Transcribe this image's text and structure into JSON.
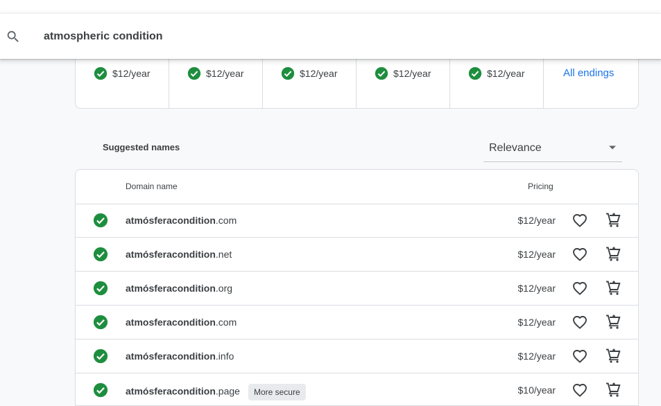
{
  "search": {
    "value": "atmospheric condition",
    "icon": "search-icon"
  },
  "endings": {
    "items": [
      {
        "price": "$12/year"
      },
      {
        "price": "$12/year"
      },
      {
        "price": "$12/year"
      },
      {
        "price": "$12/year"
      },
      {
        "price": "$12/year"
      }
    ],
    "all_label": "All endings"
  },
  "suggested": {
    "title": "Suggested names",
    "sort_value": "Relevance"
  },
  "table": {
    "headers": {
      "domain": "Domain name",
      "pricing": "Pricing"
    },
    "rows": [
      {
        "name": "atmósferacondition",
        "tld": ".com",
        "price": "$12/year",
        "badge": ""
      },
      {
        "name": "atmósferacondition",
        "tld": ".net",
        "price": "$12/year",
        "badge": ""
      },
      {
        "name": "atmósferacondition",
        "tld": ".org",
        "price": "$12/year",
        "badge": ""
      },
      {
        "name": "atmosferacondition",
        "tld": ".com",
        "price": "$12/year",
        "badge": ""
      },
      {
        "name": "atmósferacondition",
        "tld": ".info",
        "price": "$12/year",
        "badge": ""
      },
      {
        "name": "atmósferacondition",
        "tld": ".page",
        "price": "$10/year",
        "badge": "More secure"
      }
    ]
  },
  "colors": {
    "accent": "#1a73e8",
    "available": "#1e8e3e",
    "border": "#dadce0",
    "background": "#f8f9fa"
  }
}
